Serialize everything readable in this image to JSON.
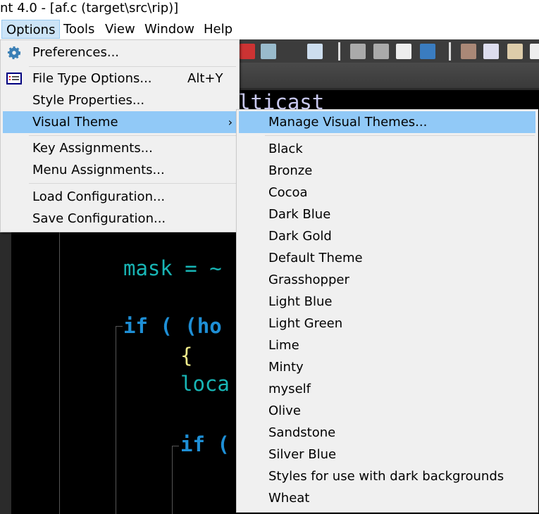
{
  "window": {
    "title": "nt 4.0 - [af.c (target\\src\\rip)]"
  },
  "menubar": [
    {
      "label": "Options",
      "active": true
    },
    {
      "label": "Tools"
    },
    {
      "label": "View"
    },
    {
      "label": "Window"
    },
    {
      "label": "Help"
    }
  ],
  "editor": {
    "lines": [
      "lticast",
      "mask = ~",
      "if ( (ho",
      "{",
      "loca",
      "if ("
    ]
  },
  "options_menu": {
    "items": [
      {
        "label": "Preferences...",
        "icon": "gear-icon"
      },
      {
        "label": "File Type Options...",
        "shortcut": "Alt+Y",
        "icon": "list-icon"
      },
      {
        "label": "Style Properties..."
      },
      {
        "label": "Visual Theme",
        "submenu": true,
        "highlighted": true,
        "arrow": "›"
      },
      {
        "label": "Key Assignments..."
      },
      {
        "label": "Menu Assignments..."
      },
      {
        "label": "Load Configuration..."
      },
      {
        "label": "Save Configuration..."
      }
    ]
  },
  "theme_submenu": {
    "manage": "Manage Visual Themes...",
    "themes": [
      "Black",
      "Bronze",
      "Cocoa",
      "Dark Blue",
      "Dark Gold",
      "Default Theme",
      "Grasshopper",
      "Light Blue",
      "Light Green",
      "Lime",
      "Minty",
      "myself",
      "Olive",
      "Sandstone",
      "Silver Blue",
      "Styles for use with dark backgrounds",
      "Wheat"
    ]
  },
  "colors": {
    "highlight": "#91c9f7",
    "menu_bg": "#f0f0f0",
    "keyword": "#1e8fd6",
    "identifier": "#18b5b5",
    "operator": "#1fc01f",
    "paren": "#f5f08c"
  }
}
